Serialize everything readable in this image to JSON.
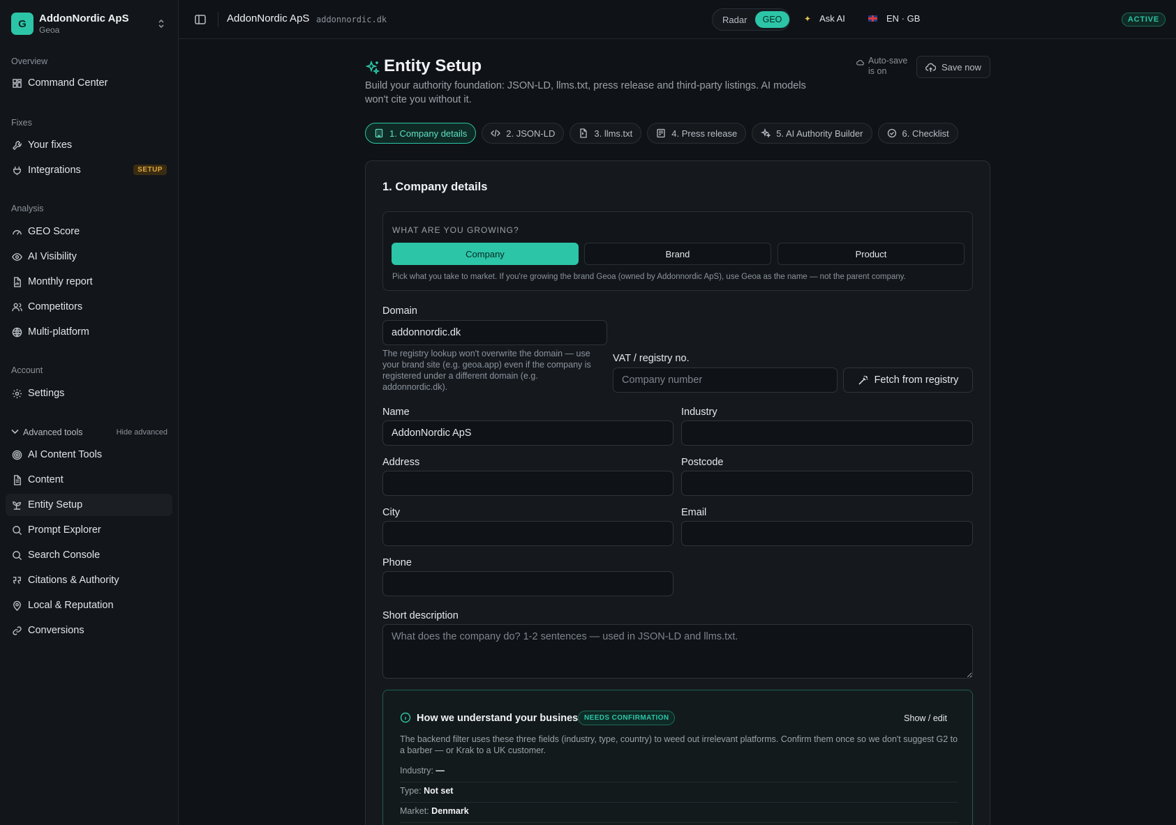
{
  "org": {
    "initial": "G",
    "name": "AddonNordic ApS",
    "product": "Geoa"
  },
  "sidebar": {
    "sections": {
      "overview": "Overview",
      "fixes": "Fixes",
      "analysis": "Analysis",
      "account": "Account"
    },
    "items": {
      "command_center": "Command Center",
      "your_fixes": "Your fixes",
      "integrations": "Integrations",
      "integrations_badge": "SETUP",
      "geo_score": "GEO Score",
      "ai_visibility": "AI Visibility",
      "monthly_report": "Monthly report",
      "competitors": "Competitors",
      "multi_platform": "Multi-platform",
      "settings": "Settings",
      "ai_content_tools": "AI Content Tools",
      "content": "Content",
      "entity_setup": "Entity Setup",
      "prompt_explorer": "Prompt Explorer",
      "search_console": "Search Console",
      "citations_authority": "Citations & Authority",
      "local_reputation": "Local & Reputation",
      "conversions": "Conversions"
    },
    "advanced": {
      "label": "Advanced tools",
      "hide": "Hide advanced"
    }
  },
  "topbar": {
    "title": "AddonNordic ApS",
    "domain": "addonnordic.dk",
    "mode_radar": "Radar",
    "mode_geo": "GEO",
    "ask_ai": "Ask AI",
    "language": "EN · GB",
    "status": "ACTIVE"
  },
  "page": {
    "title": "Entity Setup",
    "subtitle": "Build your authority foundation: JSON-LD, llms.txt, press release and third-party listings. AI models won't cite you without it.",
    "autosave_line1": "Auto-save",
    "autosave_line2": "is on",
    "save_now": "Save now"
  },
  "tabs": [
    {
      "label": "1. Company details",
      "icon": "building-icon",
      "active": true
    },
    {
      "label": "2. JSON-LD",
      "icon": "code-icon",
      "active": false
    },
    {
      "label": "3. llms.txt",
      "icon": "file-icon",
      "active": false
    },
    {
      "label": "4. Press release",
      "icon": "newspaper-icon",
      "active": false
    },
    {
      "label": "5. AI Authority Builder",
      "icon": "sparkles-icon",
      "active": false
    },
    {
      "label": "6. Checklist",
      "icon": "check-circle-icon",
      "active": false
    }
  ],
  "form": {
    "title": "1. Company details",
    "growing": {
      "label": "WHAT ARE YOU GROWING?",
      "options": [
        "Company",
        "Brand",
        "Product"
      ],
      "selected": "Company",
      "hint": "Pick what you take to market. If you're growing the brand Geoa (owned by Addonnordic ApS), use Geoa as the name — not the parent company."
    },
    "domain": {
      "label": "Domain",
      "value": "addonnordic.dk",
      "help": "The registry lookup won't overwrite the domain — use your brand site (e.g. geoa.app) even if the company is registered under a different domain (e.g. addonnordic.dk)."
    },
    "vat": {
      "label": "VAT / registry no.",
      "placeholder": "Company number",
      "fetch": "Fetch from registry"
    },
    "name": {
      "label": "Name",
      "value": "AddonNordic ApS"
    },
    "industry": {
      "label": "Industry",
      "value": ""
    },
    "address": {
      "label": "Address",
      "value": ""
    },
    "postcode": {
      "label": "Postcode",
      "value": ""
    },
    "city": {
      "label": "City",
      "value": ""
    },
    "email": {
      "label": "Email",
      "value": ""
    },
    "phone": {
      "label": "Phone",
      "value": ""
    },
    "short_description": {
      "label": "Short description",
      "placeholder": "What does the company do? 1-2 sentences — used in JSON-LD and llms.txt."
    }
  },
  "business": {
    "title": "How we understand your business",
    "badge": "NEEDS CONFIRMATION",
    "edit": "Show / edit",
    "description": "The backend filter uses these three fields (industry, type, country) to weed out irrelevant platforms. Confirm them once so we don't suggest G2 to a barber — or Krak to a UK customer.",
    "industry_label": "Industry:",
    "industry_value": "—",
    "type_label": "Type:",
    "type_value": "Not set",
    "market_label": "Market:",
    "market_value": "Denmark"
  },
  "colors": {
    "accent": "#2cc5a7",
    "background": "#0f1216",
    "panel": "#15191e",
    "warning": "#e0a93b"
  }
}
